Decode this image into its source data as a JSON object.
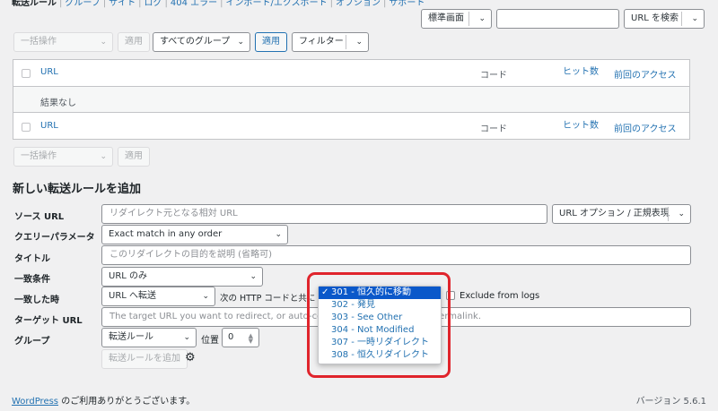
{
  "nav": {
    "items": [
      "転送ルール",
      "グループ",
      "サイト",
      "ログ",
      "404 エラー",
      "インポート/エクスポート",
      "オプション",
      "サポート"
    ]
  },
  "top": {
    "view_select": "標準画面",
    "search_placeholder": "",
    "search_button": "URL を検索",
    "bulk_action": "一括操作",
    "apply": "適用",
    "group_filter": "すべてのグループ",
    "apply_group": "適用",
    "filter": "フィルター"
  },
  "table": {
    "columns": {
      "url": "URL",
      "code": "コード",
      "hits": "ヒット数",
      "last_access": "前回のアクセス"
    },
    "no_results": "結果なし"
  },
  "bottom_bulk": {
    "bulk_action": "一括操作",
    "apply": "適用"
  },
  "form": {
    "title": "新しい転送ルールを追加",
    "source_label": "ソース URL",
    "source_placeholder": "リダイレクト元となる相対 URL",
    "url_options": "URL オプション / 正規表現",
    "query_label": "クエリーパラメータ",
    "query_value": "Exact match in any order",
    "title_label": "タイトル",
    "title_placeholder": "このリダイレクトの目的を説明 (省略可)",
    "match_label": "一致条件",
    "match_value": "URL のみ",
    "when_matched_label": "一致した時",
    "when_matched_value": "URL へ転送",
    "http_code_text": "次の HTTP コードと共に",
    "exclude_logs": "Exclude from logs",
    "target_label": "ターゲット URL",
    "target_placeholder": "The target URL you want to redirect, or auto-complete on post name or permalink.",
    "group_label": "グループ",
    "group_value": "転送ルール",
    "position_label": "位置",
    "position_value": "0",
    "add_button": "転送ルールを追加"
  },
  "http_codes": {
    "options": [
      "301 - 恒久的に移動",
      "302 - 発見",
      "303 - See Other",
      "304 - Not Modified",
      "307 - 一時リダイレクト",
      "308 - 恒久リダイレクト"
    ],
    "selected_check": "✓"
  },
  "footer": {
    "wp_link": "WordPress",
    "thanks": " のご利用ありがとうございます。",
    "version": "バージョン 5.6.1"
  },
  "colors": {
    "accent": "#2271b1",
    "highlight": "#e0242c",
    "selected_option": "#0a58ca"
  }
}
